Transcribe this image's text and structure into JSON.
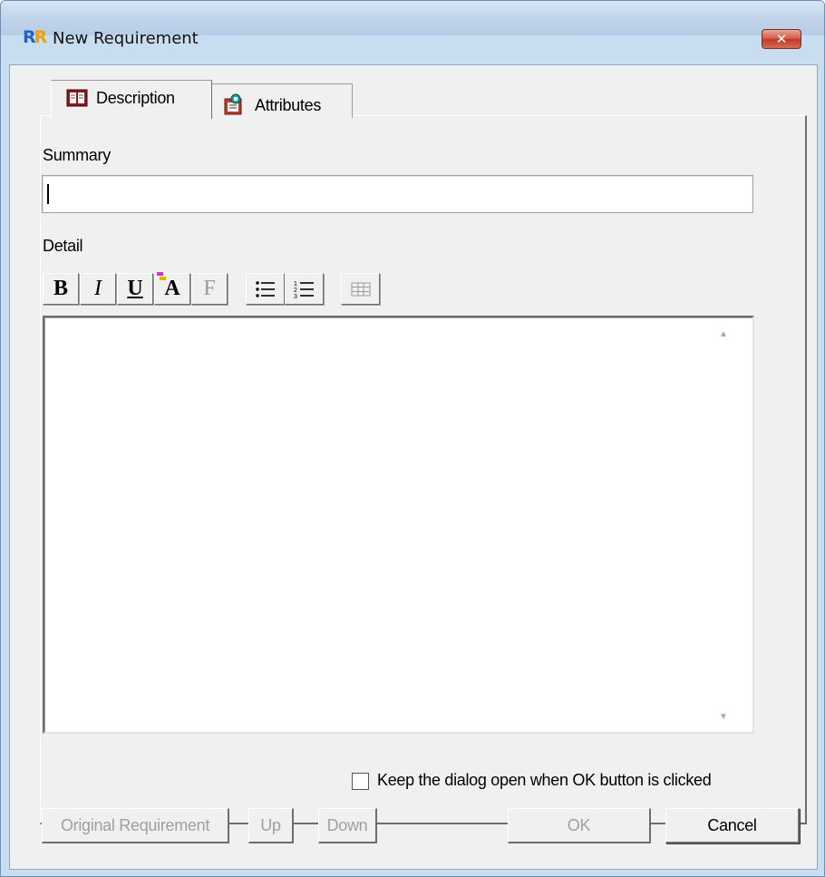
{
  "window": {
    "title": "New Requirement",
    "icon": "requirements-app-icon",
    "close_symbol": "✕"
  },
  "tabs": [
    {
      "label": "Description",
      "icon": "description-book-icon",
      "active": true
    },
    {
      "label": "Attributes",
      "icon": "attributes-clipboard-icon",
      "active": false
    }
  ],
  "summary": {
    "label": "Summary",
    "value": ""
  },
  "detail": {
    "label": "Detail",
    "toolbar": {
      "bold": "B",
      "italic": "I",
      "underline": "U",
      "font_color": "A",
      "font": "F"
    },
    "value": ""
  },
  "keep_open": {
    "label": "Keep the dialog open when OK button is clicked",
    "checked": false
  },
  "buttons": {
    "original_requirement": "Original Requirement",
    "up": "Up",
    "down": "Down",
    "ok": "OK",
    "cancel": "Cancel"
  }
}
